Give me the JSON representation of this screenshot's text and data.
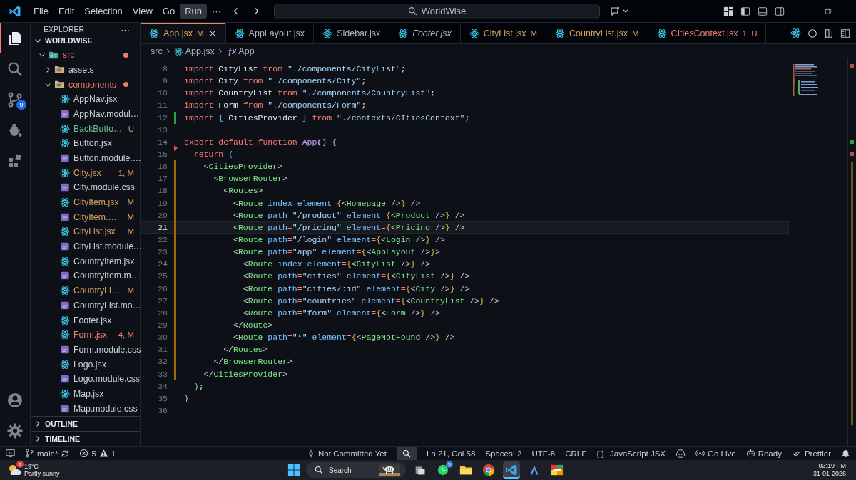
{
  "titlebar": {
    "menus": [
      {
        "label": "File",
        "selected": false
      },
      {
        "label": "Edit",
        "selected": false
      },
      {
        "label": "Selection",
        "selected": false
      },
      {
        "label": "View",
        "selected": false
      },
      {
        "label": "Go",
        "selected": false
      },
      {
        "label": "Run",
        "selected": true
      }
    ],
    "more": "···",
    "search": "WorldWise"
  },
  "activity_bar": {
    "items": [
      {
        "selected": true
      },
      {
        "selected": false
      },
      {
        "selected": false,
        "badge": "9"
      },
      {
        "selected": false
      },
      {
        "selected": false
      }
    ]
  },
  "sidebar": {
    "title": "EXPLORER",
    "more": "···",
    "root": {
      "label": "WORLDWISE",
      "expanded": true
    },
    "tree": [
      {
        "label": "src",
        "kind": "code-folder",
        "color": "#ef7d6d",
        "expanded": true,
        "children": [
          {
            "label": "assets",
            "kind": "folder",
            "expanded": false
          },
          {
            "label": "components",
            "kind": "folder",
            "color": "#ef7d6d",
            "expanded": true,
            "children": [
              {
                "label": "AppNav.jsx",
                "kind": "react"
              },
              {
                "label": "AppNav.modul…",
                "kind": "css"
              },
              {
                "label": "BackButto…",
                "kind": "react",
                "color": "#6fbf8a",
                "badge": "U"
              },
              {
                "label": "Button.jsx",
                "kind": "react"
              },
              {
                "label": "Button.module.…",
                "kind": "css"
              },
              {
                "label": "City.jsx",
                "kind": "react",
                "color": "#d9a35f",
                "badge": "1, M"
              },
              {
                "label": "City.module.css",
                "kind": "css"
              },
              {
                "label": "CityItem.jsx",
                "kind": "react",
                "color": "#d9a35f",
                "badge": "M"
              },
              {
                "label": "CityItem.…",
                "kind": "css",
                "color": "#d9a35f",
                "badge": "M"
              },
              {
                "label": "CityList.jsx",
                "kind": "react",
                "color": "#d9a35f",
                "badge": "M"
              },
              {
                "label": "CityList.module.…",
                "kind": "css"
              },
              {
                "label": "CountryItem.jsx",
                "kind": "react"
              },
              {
                "label": "CountryItem.m…",
                "kind": "css"
              },
              {
                "label": "CountryLi…",
                "kind": "react",
                "color": "#d9a35f",
                "badge": "M"
              },
              {
                "label": "CountryList.mo…",
                "kind": "css"
              },
              {
                "label": "Footer.jsx",
                "kind": "react"
              },
              {
                "label": "Form.jsx",
                "kind": "react",
                "color": "#ef7d6d",
                "badge": "4, M"
              },
              {
                "label": "Form.module.css",
                "kind": "css"
              },
              {
                "label": "Logo.jsx",
                "kind": "react"
              },
              {
                "label": "Logo.module.css",
                "kind": "css"
              },
              {
                "label": "Map.jsx",
                "kind": "react"
              },
              {
                "label": "Map.module.css",
                "kind": "css"
              }
            ]
          }
        ]
      }
    ],
    "sections": [
      {
        "label": "OUTLINE",
        "expanded": false
      },
      {
        "label": "TIMELINE",
        "expanded": false
      }
    ]
  },
  "tabs": [
    {
      "label": "App.jsx",
      "badge": "M",
      "color": "#d9a35f",
      "selected": true,
      "preview": false
    },
    {
      "label": "AppLayout.jsx",
      "selected": false,
      "preview": false
    },
    {
      "label": "Sidebar.jsx",
      "selected": false,
      "preview": false
    },
    {
      "label": "Footer.jsx",
      "selected": false,
      "preview": true
    },
    {
      "label": "CityList.jsx",
      "badge": "M",
      "color": "#d9a35f",
      "selected": false,
      "preview": false
    },
    {
      "label": "CountryList.jsx",
      "badge": "M",
      "color": "#d9a35f",
      "selected": false,
      "preview": false
    },
    {
      "label": "CItiesContext.jsx",
      "badge": "1, U",
      "color": "#ef7d6d",
      "selected": false,
      "preview": false
    }
  ],
  "breadcrumb": {
    "folder": "src",
    "file": "App.jsx",
    "symbol_icon": "ƒx",
    "symbol": "App"
  },
  "code": [
    {
      "n": "8",
      "selected": false,
      "t": [
        {
          "kind": "kw",
          "text": "import"
        },
        {
          "kind": "id",
          "text": " CityList "
        },
        {
          "kind": "kw",
          "text": "from"
        },
        {
          "kind": "str",
          "text": " \"./components/CityList\""
        },
        {
          "kind": "p",
          "text": ";"
        }
      ]
    },
    {
      "n": "9",
      "selected": false,
      "t": [
        {
          "kind": "kw",
          "text": "import"
        },
        {
          "kind": "id",
          "text": " City "
        },
        {
          "kind": "kw",
          "text": "from"
        },
        {
          "kind": "str",
          "text": " \"./components/City\""
        },
        {
          "kind": "p",
          "text": ";"
        }
      ]
    },
    {
      "n": "10",
      "selected": false,
      "t": [
        {
          "kind": "kw",
          "text": "import"
        },
        {
          "kind": "id",
          "text": " CountryList "
        },
        {
          "kind": "kw",
          "text": "from"
        },
        {
          "kind": "str",
          "text": " \"./components/CountryList\""
        },
        {
          "kind": "p",
          "text": ";"
        }
      ]
    },
    {
      "n": "11",
      "selected": false,
      "t": [
        {
          "kind": "kw",
          "text": "import"
        },
        {
          "kind": "id",
          "text": " Form "
        },
        {
          "kind": "kw",
          "text": "from"
        },
        {
          "kind": "str",
          "text": " \"./components/Form\""
        },
        {
          "kind": "p",
          "text": ";"
        }
      ]
    },
    {
      "n": "12",
      "selected": false,
      "gutter": {
        "kind": "bar",
        "color": "#2ea043"
      },
      "t": [
        {
          "kind": "kw",
          "text": "import "
        },
        {
          "kind": "br2",
          "text": "{"
        },
        {
          "kind": "id",
          "text": " CitiesProvider "
        },
        {
          "kind": "br2",
          "text": "} "
        },
        {
          "kind": "kw",
          "text": "from"
        },
        {
          "kind": "str",
          "text": " \"./contexts/CItiesContext\""
        },
        {
          "kind": "p",
          "text": ";"
        }
      ]
    },
    {
      "n": "13",
      "selected": false
    },
    {
      "n": "14",
      "selected": false,
      "t": [
        {
          "kind": "kw",
          "text": "export default function "
        },
        {
          "kind": "fn",
          "text": "App"
        },
        {
          "kind": "p",
          "text": "() "
        },
        {
          "kind": "br2",
          "text": "{"
        }
      ]
    },
    {
      "n": "15",
      "selected": false,
      "gutter": {
        "kind": "triangle",
        "color": "#f85149"
      },
      "t": [
        {
          "kind": "kw",
          "text": "  return "
        },
        {
          "kind": "br2",
          "text": "("
        }
      ]
    },
    {
      "n": "16",
      "selected": false,
      "gutter": {
        "kind": "bar",
        "color": "#9e6a03"
      },
      "t": [
        {
          "kind": "ang",
          "text": "    <"
        },
        {
          "kind": "tag",
          "text": "CitiesProvider"
        },
        {
          "kind": "ang",
          "text": ">"
        }
      ]
    },
    {
      "n": "17",
      "selected": false,
      "gutter": {
        "kind": "bar",
        "color": "#9e6a03"
      },
      "t": [
        {
          "kind": "ang",
          "text": "      <"
        },
        {
          "kind": "tag",
          "text": "BrowserRouter"
        },
        {
          "kind": "ang",
          "text": ">"
        }
      ]
    },
    {
      "n": "18",
      "selected": false,
      "gutter": {
        "kind": "bar",
        "color": "#9e6a03"
      },
      "t": [
        {
          "kind": "ang",
          "text": "        <"
        },
        {
          "kind": "tag",
          "text": "Routes"
        },
        {
          "kind": "ang",
          "text": ">"
        }
      ]
    },
    {
      "n": "19",
      "selected": false,
      "gutter": {
        "kind": "bar",
        "color": "#9e6a03"
      },
      "t": [
        {
          "kind": "ang",
          "text": "          <"
        },
        {
          "kind": "tag",
          "text": "Route"
        },
        {
          "kind": "attr",
          "text": " index element"
        },
        {
          "kind": "op",
          "text": "="
        },
        {
          "kind": "br",
          "text": "{"
        },
        {
          "kind": "ang",
          "text": "<"
        },
        {
          "kind": "tag",
          "text": "Homepage"
        },
        {
          "kind": "ang",
          "text": " />"
        },
        {
          "kind": "br",
          "text": "}"
        },
        {
          "kind": "ang",
          "text": " />"
        }
      ]
    },
    {
      "n": "20",
      "selected": false,
      "gutter": {
        "kind": "bar",
        "color": "#9e6a03"
      },
      "t": [
        {
          "kind": "ang",
          "text": "          <"
        },
        {
          "kind": "tag",
          "text": "Route"
        },
        {
          "kind": "attr",
          "text": " path"
        },
        {
          "kind": "op",
          "text": "="
        },
        {
          "kind": "str",
          "text": "\"/product\""
        },
        {
          "kind": "attr",
          "text": " element"
        },
        {
          "kind": "op",
          "text": "="
        },
        {
          "kind": "br",
          "text": "{"
        },
        {
          "kind": "ang",
          "text": "<"
        },
        {
          "kind": "tag",
          "text": "Product"
        },
        {
          "kind": "ang",
          "text": " />"
        },
        {
          "kind": "br",
          "text": "}"
        },
        {
          "kind": "ang",
          "text": " />"
        }
      ]
    },
    {
      "n": "21",
      "selected": true,
      "gutter": {
        "kind": "bar",
        "color": "#9e6a03"
      },
      "t": [
        {
          "kind": "ang",
          "text": "          <"
        },
        {
          "kind": "tag",
          "text": "Route"
        },
        {
          "kind": "attr",
          "text": " path"
        },
        {
          "kind": "op",
          "text": "="
        },
        {
          "kind": "str",
          "text": "\"/pricing\""
        },
        {
          "kind": "attr",
          "text": " element"
        },
        {
          "kind": "op",
          "text": "="
        },
        {
          "kind": "br",
          "text": "{"
        },
        {
          "kind": "ang",
          "text": "<"
        },
        {
          "kind": "tag",
          "text": "Pricing"
        },
        {
          "kind": "ang",
          "text": " />"
        },
        {
          "kind": "br",
          "text": "}"
        },
        {
          "kind": "ang",
          "text": " />"
        }
      ]
    },
    {
      "n": "22",
      "selected": false,
      "gutter": {
        "kind": "bar",
        "color": "#9e6a03"
      },
      "t": [
        {
          "kind": "ang",
          "text": "          <"
        },
        {
          "kind": "tag",
          "text": "Route"
        },
        {
          "kind": "attr",
          "text": " path"
        },
        {
          "kind": "op",
          "text": "="
        },
        {
          "kind": "str",
          "text": "\"/login\""
        },
        {
          "kind": "attr",
          "text": " element"
        },
        {
          "kind": "op",
          "text": "="
        },
        {
          "kind": "br",
          "text": "{"
        },
        {
          "kind": "ang",
          "text": "<"
        },
        {
          "kind": "tag",
          "text": "Login"
        },
        {
          "kind": "ang",
          "text": " />"
        },
        {
          "kind": "br",
          "text": "}"
        },
        {
          "kind": "ang",
          "text": " />"
        }
      ]
    },
    {
      "n": "23",
      "selected": false,
      "gutter": {
        "kind": "bar",
        "color": "#9e6a03"
      },
      "t": [
        {
          "kind": "ang",
          "text": "          <"
        },
        {
          "kind": "tag",
          "text": "Route"
        },
        {
          "kind": "attr",
          "text": " path"
        },
        {
          "kind": "op",
          "text": "="
        },
        {
          "kind": "str",
          "text": "\"app\""
        },
        {
          "kind": "attr",
          "text": " element"
        },
        {
          "kind": "op",
          "text": "="
        },
        {
          "kind": "br",
          "text": "{"
        },
        {
          "kind": "ang",
          "text": "<"
        },
        {
          "kind": "tag",
          "text": "AppLayout"
        },
        {
          "kind": "ang",
          "text": " />"
        },
        {
          "kind": "br",
          "text": "}"
        },
        {
          "kind": "ang",
          "text": ">"
        }
      ]
    },
    {
      "n": "24",
      "selected": false,
      "gutter": {
        "kind": "bar",
        "color": "#9e6a03"
      },
      "t": [
        {
          "kind": "ang",
          "text": "            <"
        },
        {
          "kind": "tag",
          "text": "Route"
        },
        {
          "kind": "attr",
          "text": " index element"
        },
        {
          "kind": "op",
          "text": "="
        },
        {
          "kind": "br",
          "text": "{"
        },
        {
          "kind": "ang",
          "text": "<"
        },
        {
          "kind": "tag",
          "text": "CityList"
        },
        {
          "kind": "ang",
          "text": " />"
        },
        {
          "kind": "br",
          "text": "}"
        },
        {
          "kind": "ang",
          "text": " />"
        }
      ]
    },
    {
      "n": "25",
      "selected": false,
      "gutter": {
        "kind": "bar",
        "color": "#9e6a03"
      },
      "t": [
        {
          "kind": "ang",
          "text": "            <"
        },
        {
          "kind": "tag",
          "text": "Route"
        },
        {
          "kind": "attr",
          "text": " path"
        },
        {
          "kind": "op",
          "text": "="
        },
        {
          "kind": "str",
          "text": "\"cities\""
        },
        {
          "kind": "attr",
          "text": " element"
        },
        {
          "kind": "op",
          "text": "="
        },
        {
          "kind": "br",
          "text": "{"
        },
        {
          "kind": "ang",
          "text": "<"
        },
        {
          "kind": "tag",
          "text": "CityList"
        },
        {
          "kind": "ang",
          "text": " />"
        },
        {
          "kind": "br",
          "text": "}"
        },
        {
          "kind": "ang",
          "text": " />"
        }
      ]
    },
    {
      "n": "26",
      "selected": false,
      "gutter": {
        "kind": "bar",
        "color": "#9e6a03"
      },
      "t": [
        {
          "kind": "ang",
          "text": "            <"
        },
        {
          "kind": "tag",
          "text": "Route"
        },
        {
          "kind": "attr",
          "text": " path"
        },
        {
          "kind": "op",
          "text": "="
        },
        {
          "kind": "str",
          "text": "\"cities/:id\""
        },
        {
          "kind": "attr",
          "text": " element"
        },
        {
          "kind": "op",
          "text": "="
        },
        {
          "kind": "br",
          "text": "{"
        },
        {
          "kind": "ang",
          "text": "<"
        },
        {
          "kind": "tag",
          "text": "City"
        },
        {
          "kind": "ang",
          "text": " />"
        },
        {
          "kind": "br",
          "text": "}"
        },
        {
          "kind": "ang",
          "text": " />"
        }
      ]
    },
    {
      "n": "27",
      "selected": false,
      "gutter": {
        "kind": "bar",
        "color": "#9e6a03"
      },
      "t": [
        {
          "kind": "ang",
          "text": "            <"
        },
        {
          "kind": "tag",
          "text": "Route"
        },
        {
          "kind": "attr",
          "text": " path"
        },
        {
          "kind": "op",
          "text": "="
        },
        {
          "kind": "str",
          "text": "\"countries\""
        },
        {
          "kind": "attr",
          "text": " element"
        },
        {
          "kind": "op",
          "text": "="
        },
        {
          "kind": "br",
          "text": "{"
        },
        {
          "kind": "ang",
          "text": "<"
        },
        {
          "kind": "tag",
          "text": "CountryList"
        },
        {
          "kind": "ang",
          "text": " />"
        },
        {
          "kind": "br",
          "text": "}"
        },
        {
          "kind": "ang",
          "text": " />"
        }
      ]
    },
    {
      "n": "28",
      "selected": false,
      "gutter": {
        "kind": "bar",
        "color": "#9e6a03"
      },
      "t": [
        {
          "kind": "ang",
          "text": "            <"
        },
        {
          "kind": "tag",
          "text": "Route"
        },
        {
          "kind": "attr",
          "text": " path"
        },
        {
          "kind": "op",
          "text": "="
        },
        {
          "kind": "str",
          "text": "\"form\""
        },
        {
          "kind": "attr",
          "text": " element"
        },
        {
          "kind": "op",
          "text": "="
        },
        {
          "kind": "br",
          "text": "{"
        },
        {
          "kind": "ang",
          "text": "<"
        },
        {
          "kind": "tag",
          "text": "Form"
        },
        {
          "kind": "ang",
          "text": " />"
        },
        {
          "kind": "br",
          "text": "}"
        },
        {
          "kind": "ang",
          "text": " />"
        }
      ]
    },
    {
      "n": "29",
      "selected": false,
      "gutter": {
        "kind": "bar",
        "color": "#9e6a03"
      },
      "t": [
        {
          "kind": "ang",
          "text": "          </"
        },
        {
          "kind": "tag",
          "text": "Route"
        },
        {
          "kind": "ang",
          "text": ">"
        }
      ]
    },
    {
      "n": "30",
      "selected": false,
      "gutter": {
        "kind": "bar",
        "color": "#9e6a03"
      },
      "t": [
        {
          "kind": "ang",
          "text": "          <"
        },
        {
          "kind": "tag",
          "text": "Route"
        },
        {
          "kind": "attr",
          "text": " path"
        },
        {
          "kind": "op",
          "text": "="
        },
        {
          "kind": "str",
          "text": "\"*\""
        },
        {
          "kind": "attr",
          "text": " element"
        },
        {
          "kind": "op",
          "text": "="
        },
        {
          "kind": "br",
          "text": "{"
        },
        {
          "kind": "ang",
          "text": "<"
        },
        {
          "kind": "tag",
          "text": "PageNotFound"
        },
        {
          "kind": "ang",
          "text": " />"
        },
        {
          "kind": "br",
          "text": "}"
        },
        {
          "kind": "ang",
          "text": " />"
        }
      ]
    },
    {
      "n": "31",
      "selected": false,
      "gutter": {
        "kind": "bar",
        "color": "#9e6a03"
      },
      "t": [
        {
          "kind": "ang",
          "text": "        </"
        },
        {
          "kind": "tag",
          "text": "Routes"
        },
        {
          "kind": "ang",
          "text": ">"
        }
      ]
    },
    {
      "n": "32",
      "selected": false,
      "gutter": {
        "kind": "bar",
        "color": "#9e6a03"
      },
      "t": [
        {
          "kind": "ang",
          "text": "      </"
        },
        {
          "kind": "tag",
          "text": "BrowserRouter"
        },
        {
          "kind": "ang",
          "text": ">"
        }
      ]
    },
    {
      "n": "33",
      "selected": false,
      "gutter": {
        "kind": "bar",
        "color": "#9e6a03"
      },
      "t": [
        {
          "kind": "ang",
          "text": "    </"
        },
        {
          "kind": "tag",
          "text": "CitiesProvider"
        },
        {
          "kind": "ang",
          "text": ">"
        }
      ]
    },
    {
      "n": "34",
      "selected": false,
      "t": [
        {
          "kind": "grn",
          "text": "  )"
        },
        {
          "kind": "p",
          "text": ";"
        }
      ]
    },
    {
      "n": "35",
      "selected": false,
      "t": [
        {
          "kind": "br2",
          "text": "}"
        }
      ]
    },
    {
      "n": "36",
      "selected": false
    }
  ],
  "status_bar": {
    "branch": "main*",
    "errors": "5",
    "warnings": "1",
    "blame": "Not Committed Yet",
    "position": "Ln 21, Col 58",
    "indent": "Spaces: 2",
    "encoding": "UTF-8",
    "eol": "CRLF",
    "language_braces": "{ }",
    "language": "JavaScript JSX",
    "live": "Go Live",
    "ready": "Ready",
    "formatter": "Prettier"
  },
  "taskbar": {
    "weather": {
      "badge": "1",
      "temp": "19°C",
      "desc": "Partly sunny"
    },
    "search": "Search",
    "apps": [
      {
        "selected": false
      },
      {
        "selected": false,
        "badge": "5"
      },
      {
        "selected": false
      },
      {
        "selected": false
      },
      {
        "selected": true
      },
      {
        "selected": false
      },
      {
        "selected": false
      }
    ],
    "time": "03:19 PM",
    "date": "31-01-2026"
  }
}
